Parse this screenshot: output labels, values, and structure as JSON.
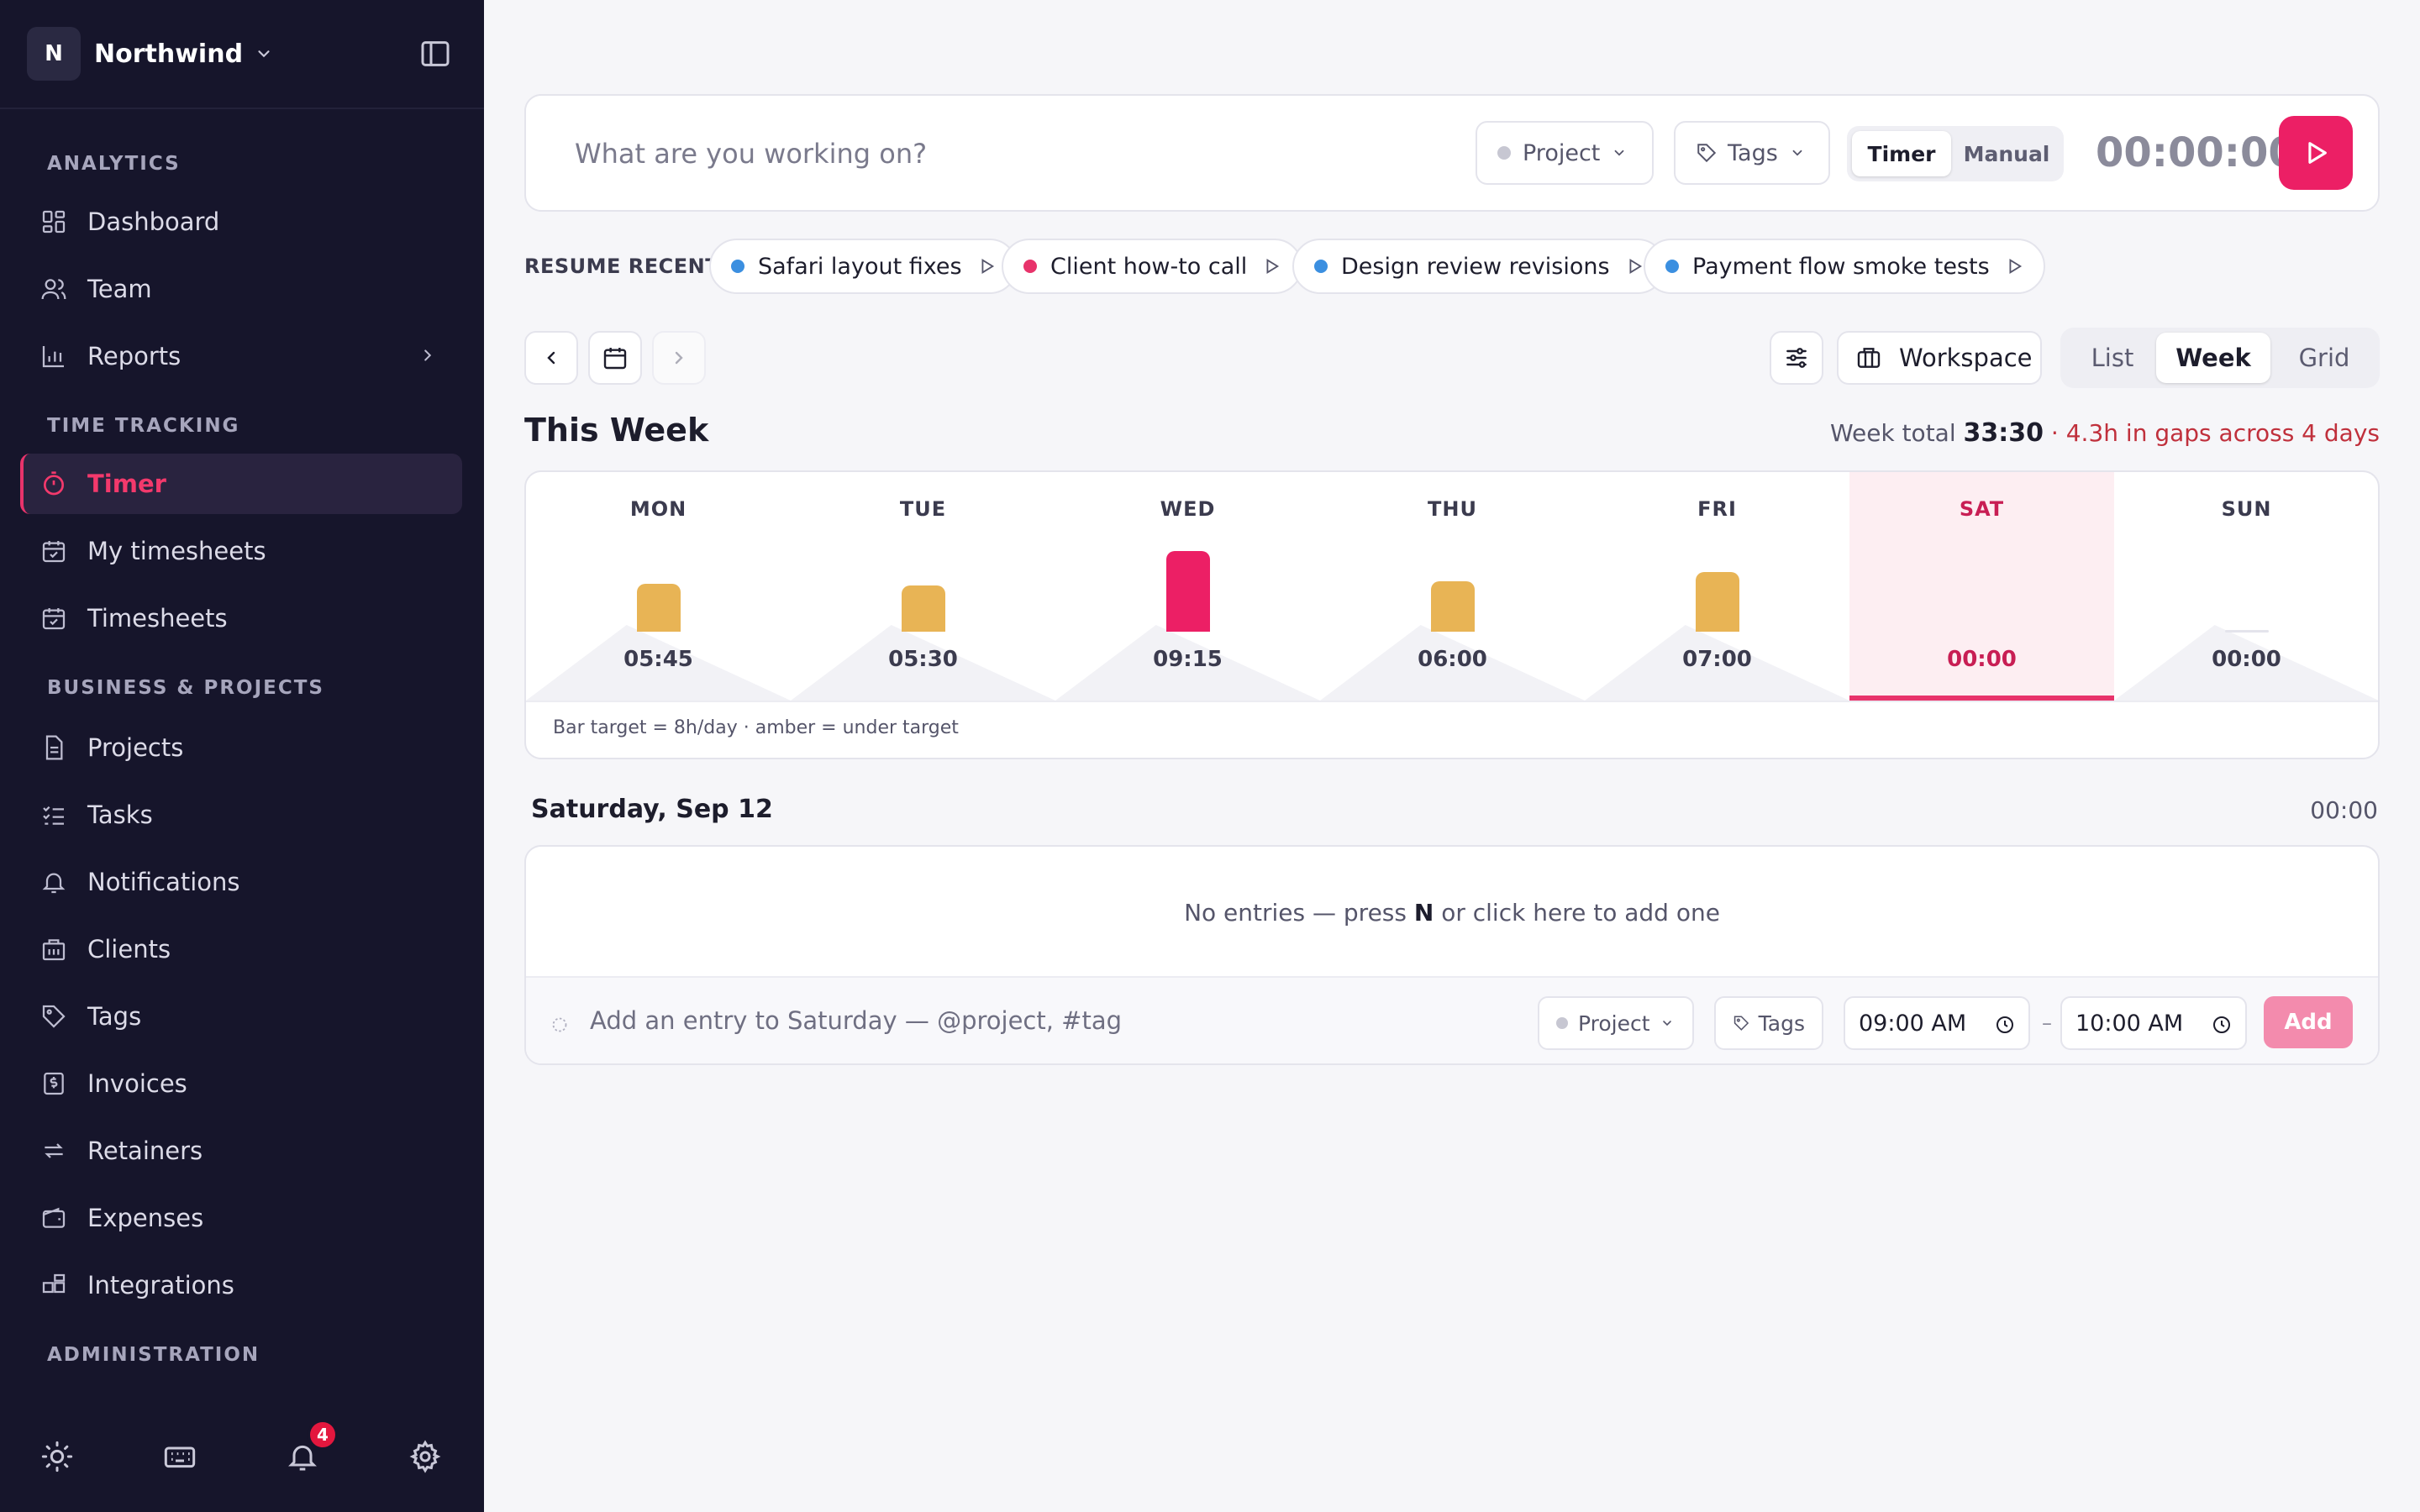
{
  "workspace": {
    "initial": "N",
    "name": "Northwind"
  },
  "sidebar": {
    "sections": [
      {
        "label": "ANALYTICS"
      },
      {
        "label": "TIME TRACKING"
      },
      {
        "label": "BUSINESS & PROJECTS"
      },
      {
        "label": "ADMINISTRATION"
      }
    ],
    "items": [
      {
        "label": "Dashboard",
        "icon": "dashboard-icon"
      },
      {
        "label": "Team",
        "icon": "team-icon"
      },
      {
        "label": "Reports",
        "icon": "reports-icon"
      },
      {
        "label": "Timer",
        "icon": "timer-icon",
        "active": true
      },
      {
        "label": "My timesheets",
        "icon": "calendar-icon"
      },
      {
        "label": "Timesheets",
        "icon": "calendar-icon"
      },
      {
        "label": "Projects",
        "icon": "document-icon"
      },
      {
        "label": "Tasks",
        "icon": "checklist-icon"
      },
      {
        "label": "Notifications",
        "icon": "bell-icon"
      },
      {
        "label": "Clients",
        "icon": "building-icon"
      },
      {
        "label": "Tags",
        "icon": "tag-icon"
      },
      {
        "label": "Invoices",
        "icon": "invoice-icon"
      },
      {
        "label": "Retainers",
        "icon": "repeat-icon"
      },
      {
        "label": "Expenses",
        "icon": "wallet-icon"
      },
      {
        "label": "Integrations",
        "icon": "puzzle-icon"
      }
    ],
    "notification_count": "4"
  },
  "entry": {
    "placeholder": "What are you working on?",
    "project_label": "Project",
    "tags_label": "Tags",
    "mode_timer": "Timer",
    "mode_manual": "Manual",
    "clock": "00:00:00"
  },
  "resume": {
    "label": "RESUME RECENT",
    "items": [
      {
        "label": "Safari layout fixes",
        "color": "#3b8fe0"
      },
      {
        "label": "Client how-to call",
        "color": "#e8336b"
      },
      {
        "label": "Design review revisions",
        "color": "#3b8fe0"
      },
      {
        "label": "Payment flow smoke tests",
        "color": "#3b8fe0"
      }
    ]
  },
  "toolbar": {
    "workspace_label": "Workspace",
    "views": [
      "List",
      "Week",
      "Grid"
    ],
    "active_view": "Week"
  },
  "week": {
    "title": "This Week",
    "total_label": "Week total",
    "total_value": "33:30",
    "gap_text": "4.3h in gaps across 4 days",
    "hint": "Bar target = 8h/day · amber = under target",
    "days": [
      {
        "label": "MON",
        "time": "05:45",
        "hours": 5.75,
        "status": "under"
      },
      {
        "label": "TUE",
        "time": "05:30",
        "hours": 5.5,
        "status": "under"
      },
      {
        "label": "WED",
        "time": "09:15",
        "hours": 9.25,
        "status": "over"
      },
      {
        "label": "THU",
        "time": "06:00",
        "hours": 6.0,
        "status": "under"
      },
      {
        "label": "FRI",
        "time": "07:00",
        "hours": 7.0,
        "status": "under"
      },
      {
        "label": "SAT",
        "time": "00:00",
        "hours": 0,
        "status": "today"
      },
      {
        "label": "SUN",
        "time": "00:00",
        "hours": 0,
        "status": "empty"
      }
    ],
    "colors": {
      "under": "#e8b455",
      "over": "#ec1f65",
      "accent": "#e8336b"
    }
  },
  "day": {
    "heading": "Saturday, Sep 12",
    "total": "00:00",
    "empty_prefix": "No entries — press ",
    "empty_key": "N",
    "empty_suffix": " or click here to add one",
    "add_placeholder": "Add an entry to Saturday — @project, #tag",
    "project_label": "Project",
    "tags_label": "Tags",
    "start": "09:00 AM",
    "end": "10:00 AM",
    "add_label": "Add"
  }
}
